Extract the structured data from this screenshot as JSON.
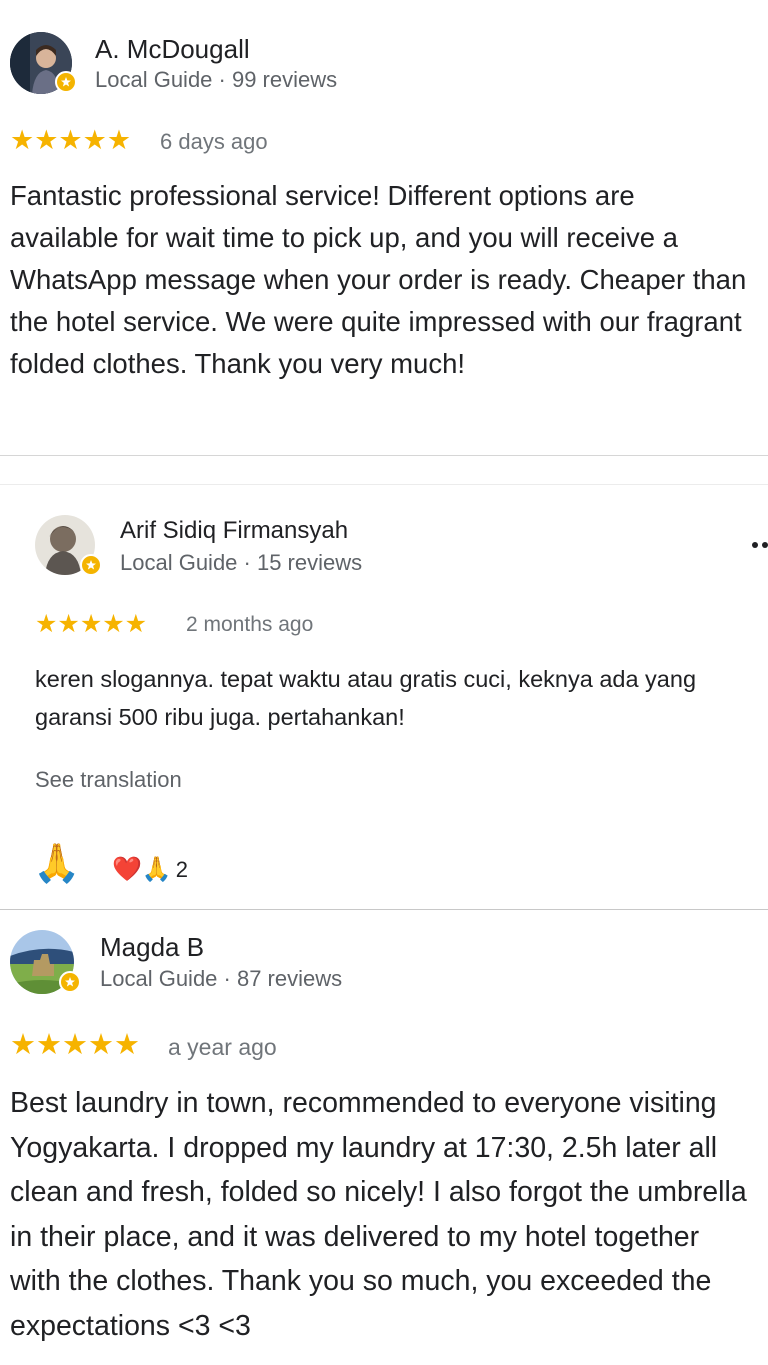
{
  "reviews": [
    {
      "name": "A. McDougall",
      "meta": "Local Guide · 99 reviews",
      "stars": "★★★★★",
      "when": "6 days ago",
      "text": "Fantastic professional service! Different options are available for wait time to pick up, and you will receive a WhatsApp message when your order is ready. Cheaper than the hotel service. We were quite impressed with our fragrant folded clothes. Thank you very much!"
    },
    {
      "name": "Arif Sidiq Firmansyah",
      "meta": "Local Guide · 15 reviews",
      "stars": "★★★★★",
      "when": "2 months ago",
      "text": "keren slogannya. tepat waktu atau gratis cuci, keknya ada yang garansi 500 ribu juga. pertahankan!",
      "see_translation": "See translation",
      "reaction_emoji": "🙏",
      "reaction_summary": "❤️🙏",
      "reaction_count": "2"
    },
    {
      "name": "Magda B",
      "meta": "Local Guide · 87 reviews",
      "stars": "★★★★★",
      "when": "a year ago",
      "text": "Best laundry in town, recommended to everyone visiting Yogyakarta. I dropped my laundry at 17:30, 2.5h later all clean and fresh, folded so nicely! I also forgot the umbrella in their place, and it was delivered to my hotel together with the clothes. Thank you so much, you exceeded the expectations <3 <3"
    }
  ],
  "colors": {
    "star": "#f6b300",
    "badge": "#f4b400",
    "meta": "#5f6368"
  },
  "icons": {
    "badge": "local-guide-star-icon",
    "more": "more-options-icon"
  }
}
